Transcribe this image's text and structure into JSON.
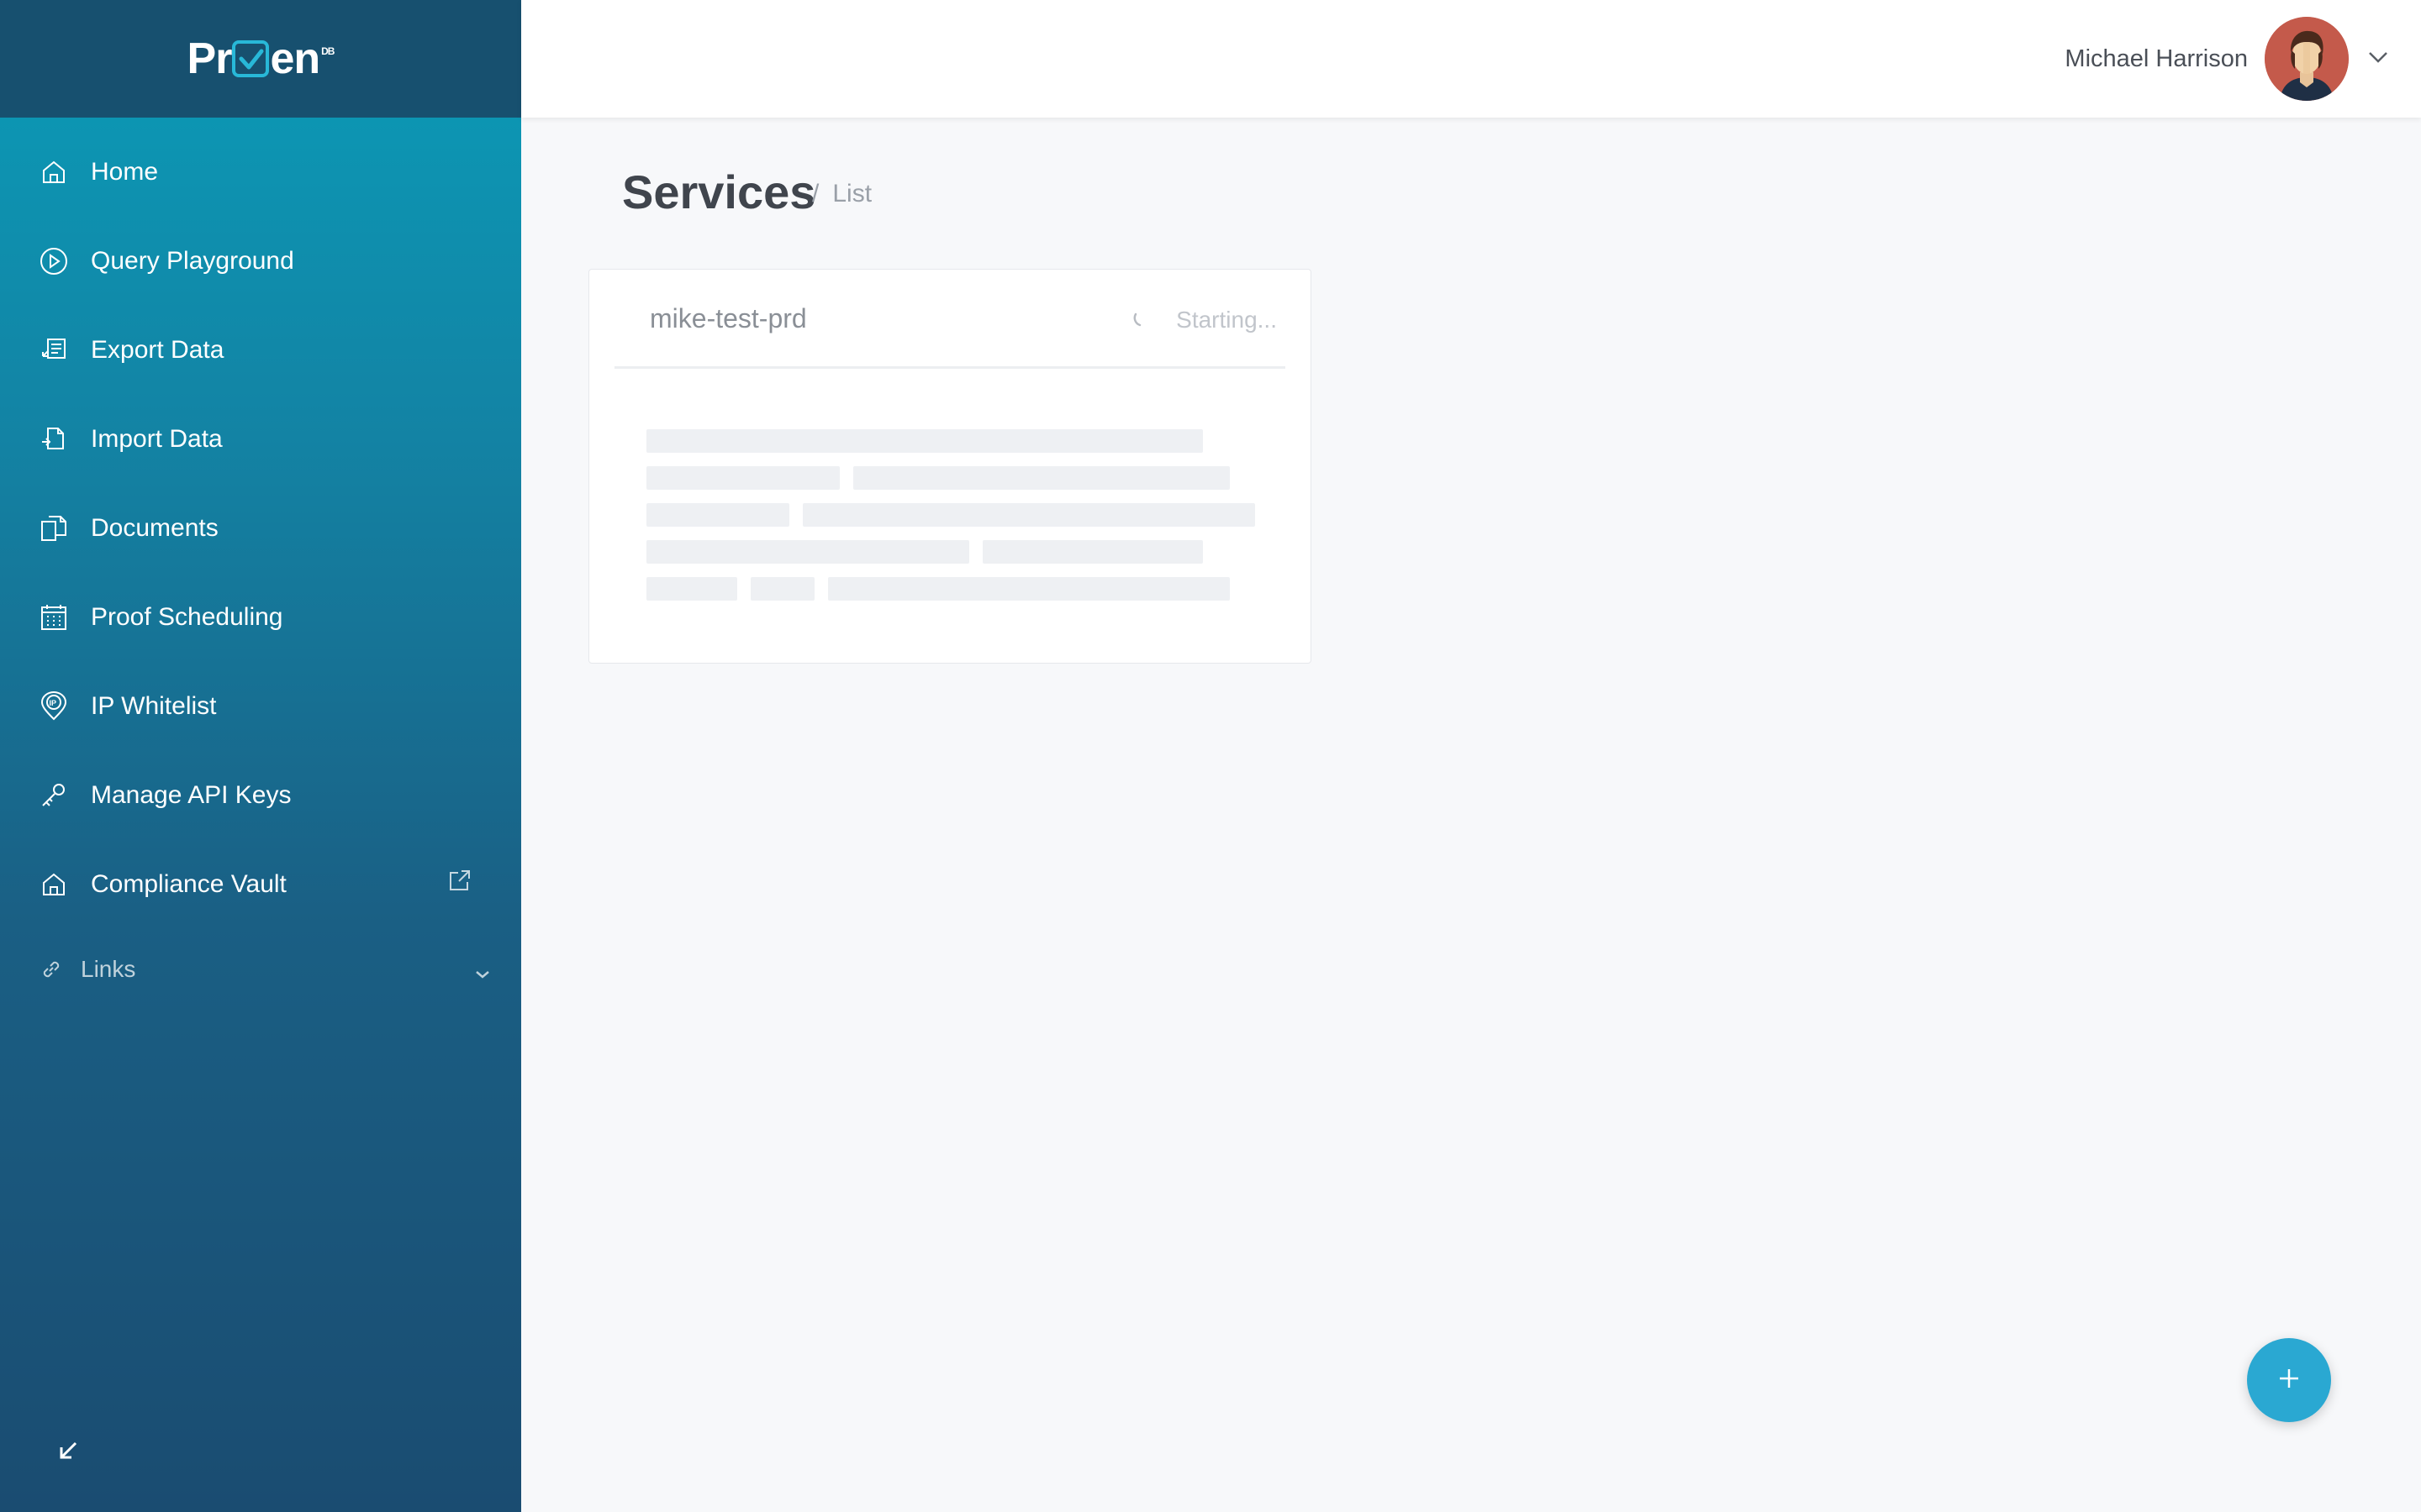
{
  "brand": {
    "logo_prefix": "Pr",
    "logo_suffix": "en",
    "logo_mark": "DB"
  },
  "sidebar": {
    "items": [
      {
        "label": "Home",
        "icon": "home-icon"
      },
      {
        "label": "Query Playground",
        "icon": "play-circle-icon"
      },
      {
        "label": "Export Data",
        "icon": "export-icon"
      },
      {
        "label": "Import Data",
        "icon": "import-icon"
      },
      {
        "label": "Documents",
        "icon": "documents-icon"
      },
      {
        "label": "Proof Scheduling",
        "icon": "calendar-icon"
      },
      {
        "label": "IP Whitelist",
        "icon": "ip-pin-icon"
      },
      {
        "label": "Manage API Keys",
        "icon": "key-icon"
      },
      {
        "label": "Compliance Vault",
        "icon": "vault-icon",
        "external": true
      }
    ],
    "links": {
      "label": "Links",
      "icon": "link-icon"
    }
  },
  "header": {
    "user_name": "Michael Harrison"
  },
  "page": {
    "title": "Services",
    "breadcrumb_sep": "/",
    "breadcrumb_current": "List"
  },
  "services": [
    {
      "name": "mike-test-prd",
      "status": "Starting..."
    }
  ],
  "colors": {
    "sidebar_top": "#0a9cb8",
    "sidebar_bottom": "#1a4c71",
    "sidebar_header": "#17506f",
    "fab": "#2aa8d2",
    "background": "#f7f8fa"
  }
}
